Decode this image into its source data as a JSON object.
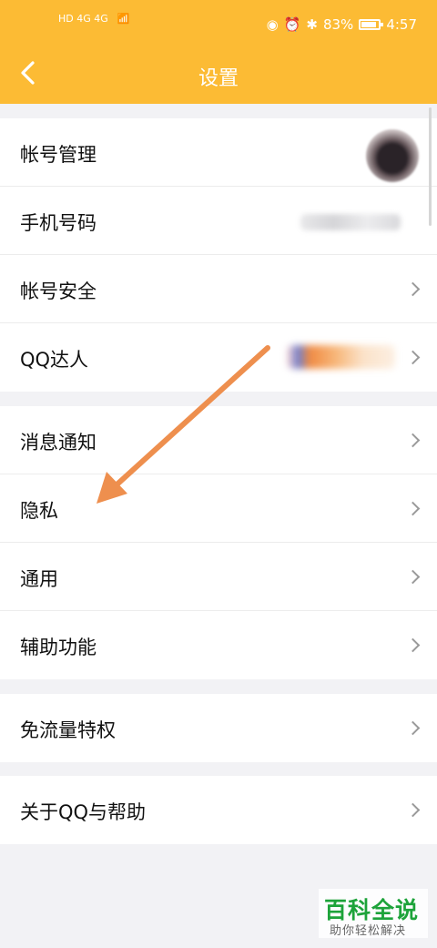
{
  "status_bar": {
    "left_signal": "HD 4G 4G",
    "battery_text": "83%",
    "time": "4:57"
  },
  "header": {
    "title": "设置",
    "back_icon": "chevron-left-icon",
    "background": "#fcbb34"
  },
  "groups": [
    {
      "items": [
        {
          "label": "帐号管理",
          "accessory": "avatar"
        },
        {
          "label": "手机号码",
          "accessory": "blurred-phone"
        },
        {
          "label": "帐号安全",
          "accessory": "chevron"
        },
        {
          "label": "QQ达人",
          "accessory": "blurred-badge-chevron"
        }
      ]
    },
    {
      "items": [
        {
          "label": "消息通知",
          "accessory": "chevron"
        },
        {
          "label": "隐私",
          "accessory": "chevron"
        },
        {
          "label": "通用",
          "accessory": "chevron"
        },
        {
          "label": "辅助功能",
          "accessory": "chevron"
        }
      ]
    },
    {
      "items": [
        {
          "label": "免流量特权",
          "accessory": "chevron"
        }
      ]
    },
    {
      "items": [
        {
          "label": "关于QQ与帮助",
          "accessory": "chevron"
        }
      ]
    }
  ],
  "annotation": {
    "color": "#ee8f4e"
  },
  "watermark": {
    "main": "百科全说",
    "sub": "助你轻松解决",
    "color": "#1da33a"
  }
}
